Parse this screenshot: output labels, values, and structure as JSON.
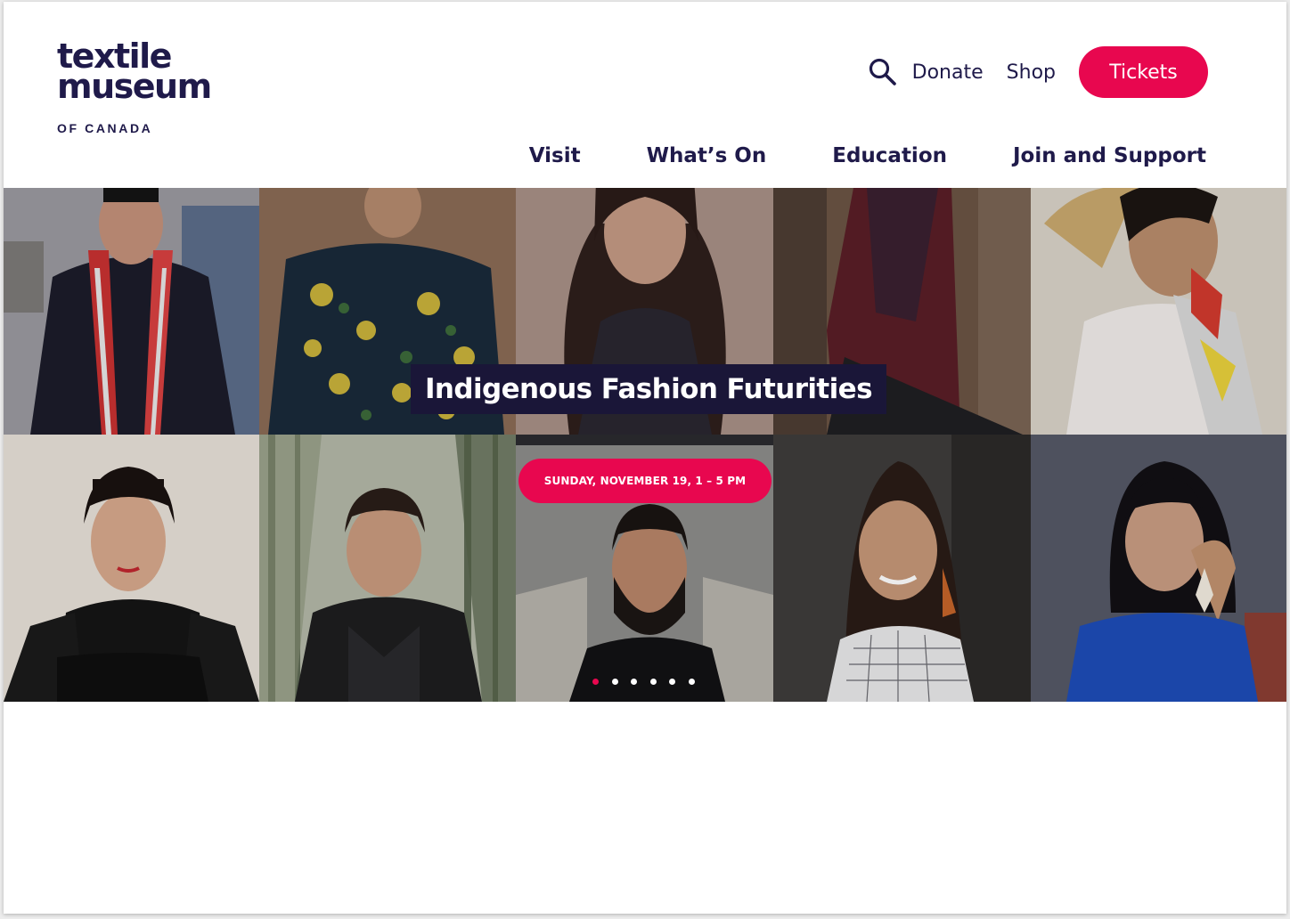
{
  "brand": {
    "line1": "textile",
    "line2": "museum",
    "line3": "OF CANADA"
  },
  "utility": {
    "search_icon": "search-icon",
    "donate": "Donate",
    "shop": "Shop",
    "tickets": "Tickets"
  },
  "nav": {
    "items": [
      {
        "label": "Visit"
      },
      {
        "label": "What’s On"
      },
      {
        "label": "Education"
      },
      {
        "label": "Join and Support"
      }
    ]
  },
  "hero": {
    "title": "Indigenous Fashion Futurities",
    "date": "SUNDAY, NOVEMBER 19, 1 – 5 PM",
    "slides": 6,
    "active_slide": 1
  },
  "colors": {
    "brand_navy": "#1f1a4a",
    "accent_pink": "#e8074f",
    "title_bg": "#1a1638"
  }
}
